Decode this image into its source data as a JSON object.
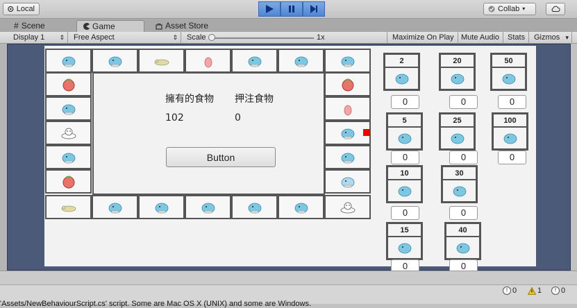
{
  "toolbar": {
    "account_label": "Local",
    "collab_label": "Collab",
    "colors": {
      "play_active": "#4f86d4"
    }
  },
  "tabs": [
    {
      "label": "Scene",
      "icon": "grid-icon"
    },
    {
      "label": "Game",
      "icon": "pacman-icon"
    },
    {
      "label": "Asset Store",
      "icon": "bag-icon"
    }
  ],
  "game_toolbar": {
    "display": "Display 1",
    "aspect": "Free Aspect",
    "scale_label": "Scale",
    "scale_value": "1x",
    "maximize": "Maximize On Play",
    "mute": "Mute Audio",
    "stats": "Stats",
    "gizmos": "Gizmos"
  },
  "panel": {
    "food_owned_label": "擁有的食物",
    "bet_food_label": "押注食物",
    "food_owned_value": "102",
    "bet_food_value": "0",
    "button_label": "Button"
  },
  "bets": [
    {
      "multiplier": "2",
      "input": "0"
    },
    {
      "multiplier": "20",
      "input": "0"
    },
    {
      "multiplier": "50",
      "input": "0"
    },
    {
      "multiplier": "5",
      "input": "0"
    },
    {
      "multiplier": "25",
      "input": "0"
    },
    {
      "multiplier": "100",
      "input": "0"
    },
    {
      "multiplier": "10",
      "input": "0"
    },
    {
      "multiplier": "30",
      "input": "0"
    },
    {
      "multiplier": "15",
      "input": "0"
    },
    {
      "multiplier": "40",
      "input": "0"
    }
  ],
  "status": {
    "info_count": "0",
    "warning_count": "1",
    "error_count": "0",
    "console_message": "'Assets/NewBehaviourScript.cs' script. Some are Mac OS X (UNIX) and some are Windows."
  }
}
